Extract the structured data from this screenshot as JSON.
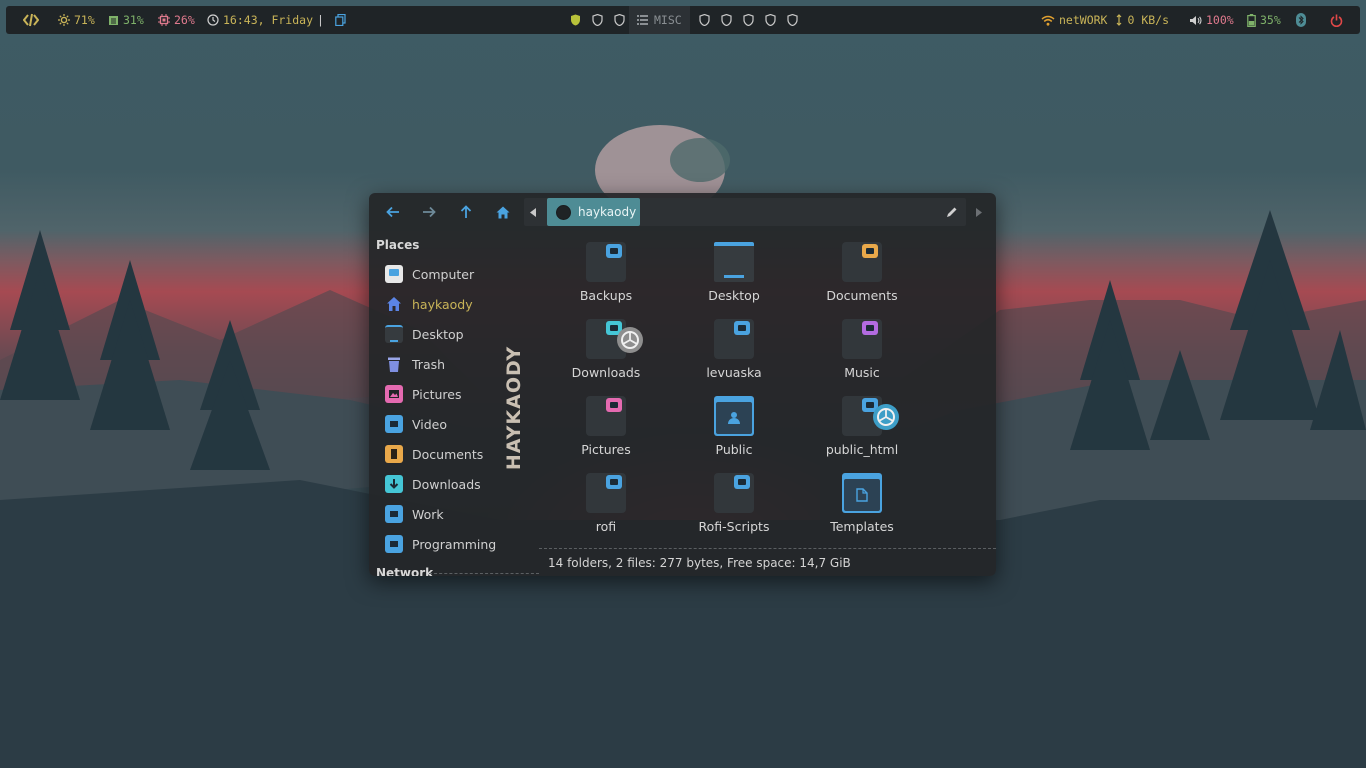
{
  "topbar": {
    "brightness": "71%",
    "memory": "31%",
    "cpu": "26%",
    "clock": "16:43, Friday",
    "separator": "|",
    "workspace_label": "MISC",
    "network_name": "netWORK",
    "network_speed": "0 KB/s",
    "volume": "100%",
    "battery": "35%"
  },
  "colors": {
    "accent_blue": "#4aa3e0",
    "accent_yellow": "#c9b458",
    "accent_pink": "#e46ab0",
    "accent_teal": "#4e8c95",
    "power_red": "#e04848"
  },
  "file_manager": {
    "breadcrumb": "haykaody",
    "places_header": "Places",
    "places": [
      {
        "label": "Computer",
        "icon": "computer-icon"
      },
      {
        "label": "haykaody",
        "icon": "home-icon"
      },
      {
        "label": "Desktop",
        "icon": "desktop-icon"
      },
      {
        "label": "Trash",
        "icon": "trash-icon"
      },
      {
        "label": "Pictures",
        "icon": "pictures-icon"
      },
      {
        "label": "Video",
        "icon": "video-folder-icon"
      },
      {
        "label": "Documents",
        "icon": "documents-icon"
      },
      {
        "label": "Downloads",
        "icon": "downloads-icon"
      },
      {
        "label": "Work",
        "icon": "folder-icon"
      },
      {
        "label": "Programming",
        "icon": "folder-icon"
      }
    ],
    "network_header": "Network",
    "side_label": "HAYKAODY",
    "items": [
      {
        "label": "Backups"
      },
      {
        "label": "Desktop"
      },
      {
        "label": "Documents"
      },
      {
        "label": "Downloads"
      },
      {
        "label": "levuaska"
      },
      {
        "label": "Music"
      },
      {
        "label": "Pictures"
      },
      {
        "label": "Public"
      },
      {
        "label": "public_html"
      },
      {
        "label": "rofi"
      },
      {
        "label": "Rofi-Scripts"
      },
      {
        "label": "Templates"
      }
    ],
    "status": "14 folders, 2 files: 277 bytes, Free space: 14,7 GiB"
  }
}
